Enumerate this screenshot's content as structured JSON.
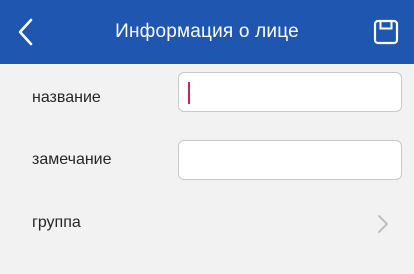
{
  "header": {
    "title": "Информация о лице",
    "back_icon": "chevron-left-icon",
    "save_icon": "floppy-disk-icon",
    "background_color": "#1e56b0"
  },
  "form": {
    "name_label": "название",
    "name_value": "",
    "note_label": "замечание",
    "note_value": "",
    "group_label": "группа",
    "group_icon": "chevron-right-icon"
  },
  "colors": {
    "cursor": "#d81b60",
    "text": "#262626",
    "field_border": "#c9c9c9"
  }
}
